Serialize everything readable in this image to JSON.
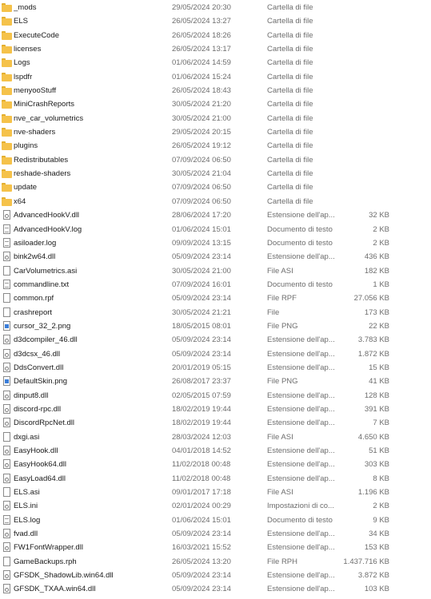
{
  "rows": [
    {
      "name": "_mods",
      "date": "29/05/2024 20:30",
      "type": "Cartella di file",
      "size": "",
      "icon": "folder-icon"
    },
    {
      "name": "ELS",
      "date": "26/05/2024 13:27",
      "type": "Cartella di file",
      "size": "",
      "icon": "folder-icon"
    },
    {
      "name": "ExecuteCode",
      "date": "26/05/2024 18:26",
      "type": "Cartella di file",
      "size": "",
      "icon": "folder-icon"
    },
    {
      "name": "licenses",
      "date": "26/05/2024 13:17",
      "type": "Cartella di file",
      "size": "",
      "icon": "folder-icon"
    },
    {
      "name": "Logs",
      "date": "01/06/2024 14:59",
      "type": "Cartella di file",
      "size": "",
      "icon": "folder-icon"
    },
    {
      "name": "lspdfr",
      "date": "01/06/2024 15:24",
      "type": "Cartella di file",
      "size": "",
      "icon": "folder-icon"
    },
    {
      "name": "menyooStuff",
      "date": "26/05/2024 18:43",
      "type": "Cartella di file",
      "size": "",
      "icon": "folder-icon"
    },
    {
      "name": "MiniCrashReports",
      "date": "30/05/2024 21:20",
      "type": "Cartella di file",
      "size": "",
      "icon": "folder-icon"
    },
    {
      "name": "nve_car_volumetrics",
      "date": "30/05/2024 21:00",
      "type": "Cartella di file",
      "size": "",
      "icon": "folder-icon"
    },
    {
      "name": "nve-shaders",
      "date": "29/05/2024 20:15",
      "type": "Cartella di file",
      "size": "",
      "icon": "folder-icon"
    },
    {
      "name": "plugins",
      "date": "26/05/2024 19:12",
      "type": "Cartella di file",
      "size": "",
      "icon": "folder-icon"
    },
    {
      "name": "Redistributables",
      "date": "07/09/2024 06:50",
      "type": "Cartella di file",
      "size": "",
      "icon": "folder-icon"
    },
    {
      "name": "reshade-shaders",
      "date": "30/05/2024 21:04",
      "type": "Cartella di file",
      "size": "",
      "icon": "folder-icon"
    },
    {
      "name": "update",
      "date": "07/09/2024 06:50",
      "type": "Cartella di file",
      "size": "",
      "icon": "folder-icon"
    },
    {
      "name": "x64",
      "date": "07/09/2024 06:50",
      "type": "Cartella di file",
      "size": "",
      "icon": "folder-icon"
    },
    {
      "name": "AdvancedHookV.dll",
      "date": "28/06/2024 17:20",
      "type": "Estensione dell'ap...",
      "size": "32 KB",
      "icon": "dll-file-icon"
    },
    {
      "name": "AdvancedHookV.log",
      "date": "01/06/2024 15:01",
      "type": "Documento di testo",
      "size": "2 KB",
      "icon": "text-file-icon"
    },
    {
      "name": "asiloader.log",
      "date": "09/09/2024 13:15",
      "type": "Documento di testo",
      "size": "2 KB",
      "icon": "text-file-icon"
    },
    {
      "name": "bink2w64.dll",
      "date": "05/09/2024 23:14",
      "type": "Estensione dell'ap...",
      "size": "436 KB",
      "icon": "dll-file-icon"
    },
    {
      "name": "CarVolumetrics.asi",
      "date": "30/05/2024 21:00",
      "type": "File ASI",
      "size": "182 KB",
      "icon": "file-icon"
    },
    {
      "name": "commandline.txt",
      "date": "07/09/2024 16:01",
      "type": "Documento di testo",
      "size": "1 KB",
      "icon": "text-file-icon"
    },
    {
      "name": "common.rpf",
      "date": "05/09/2024 23:14",
      "type": "File RPF",
      "size": "27.056 KB",
      "icon": "file-icon"
    },
    {
      "name": "crashreport",
      "date": "30/05/2024 21:21",
      "type": "File",
      "size": "173 KB",
      "icon": "file-icon"
    },
    {
      "name": "cursor_32_2.png",
      "date": "18/05/2015 08:01",
      "type": "File PNG",
      "size": "22 KB",
      "icon": "image-file-icon"
    },
    {
      "name": "d3dcompiler_46.dll",
      "date": "05/09/2024 23:14",
      "type": "Estensione dell'ap...",
      "size": "3.783 KB",
      "icon": "dll-file-icon"
    },
    {
      "name": "d3dcsx_46.dll",
      "date": "05/09/2024 23:14",
      "type": "Estensione dell'ap...",
      "size": "1.872 KB",
      "icon": "dll-file-icon"
    },
    {
      "name": "DdsConvert.dll",
      "date": "20/01/2019 05:15",
      "type": "Estensione dell'ap...",
      "size": "15 KB",
      "icon": "dll-file-icon"
    },
    {
      "name": "DefaultSkin.png",
      "date": "26/08/2017 23:37",
      "type": "File PNG",
      "size": "41 KB",
      "icon": "image-file-icon"
    },
    {
      "name": "dinput8.dll",
      "date": "02/05/2015 07:59",
      "type": "Estensione dell'ap...",
      "size": "128 KB",
      "icon": "dll-file-icon"
    },
    {
      "name": "discord-rpc.dll",
      "date": "18/02/2019 19:44",
      "type": "Estensione dell'ap...",
      "size": "391 KB",
      "icon": "dll-file-icon"
    },
    {
      "name": "DiscordRpcNet.dll",
      "date": "18/02/2019 19:44",
      "type": "Estensione dell'ap...",
      "size": "7 KB",
      "icon": "dll-file-icon"
    },
    {
      "name": "dxgi.asi",
      "date": "28/03/2024 12:03",
      "type": "File ASI",
      "size": "4.650 KB",
      "icon": "file-icon"
    },
    {
      "name": "EasyHook.dll",
      "date": "04/01/2018 14:52",
      "type": "Estensione dell'ap...",
      "size": "51 KB",
      "icon": "dll-file-icon"
    },
    {
      "name": "EasyHook64.dll",
      "date": "11/02/2018 00:48",
      "type": "Estensione dell'ap...",
      "size": "303 KB",
      "icon": "dll-file-icon"
    },
    {
      "name": "EasyLoad64.dll",
      "date": "11/02/2018 00:48",
      "type": "Estensione dell'ap...",
      "size": "8 KB",
      "icon": "dll-file-icon"
    },
    {
      "name": "ELS.asi",
      "date": "09/01/2017 17:18",
      "type": "File ASI",
      "size": "1.196 KB",
      "icon": "file-icon"
    },
    {
      "name": "ELS.ini",
      "date": "02/01/2024 00:29",
      "type": "Impostazioni di co...",
      "size": "2 KB",
      "icon": "settings-file-icon"
    },
    {
      "name": "ELS.log",
      "date": "01/06/2024 15:01",
      "type": "Documento di testo",
      "size": "9 KB",
      "icon": "text-file-icon"
    },
    {
      "name": "fvad.dll",
      "date": "05/09/2024 23:14",
      "type": "Estensione dell'ap...",
      "size": "34 KB",
      "icon": "dll-file-icon"
    },
    {
      "name": "FW1FontWrapper.dll",
      "date": "16/03/2021 15:52",
      "type": "Estensione dell'ap...",
      "size": "153 KB",
      "icon": "dll-file-icon"
    },
    {
      "name": "GameBackups.rph",
      "date": "26/05/2024 13:20",
      "type": "File RPH",
      "size": "1.437.716 KB",
      "icon": "file-icon"
    },
    {
      "name": "GFSDK_ShadowLib.win64.dll",
      "date": "05/09/2024 23:14",
      "type": "Estensione dell'ap...",
      "size": "3.872 KB",
      "icon": "dll-file-icon"
    },
    {
      "name": "GFSDK_TXAA.win64.dll",
      "date": "05/09/2024 23:14",
      "type": "Estensione dell'ap...",
      "size": "103 KB",
      "icon": "dll-file-icon"
    }
  ]
}
